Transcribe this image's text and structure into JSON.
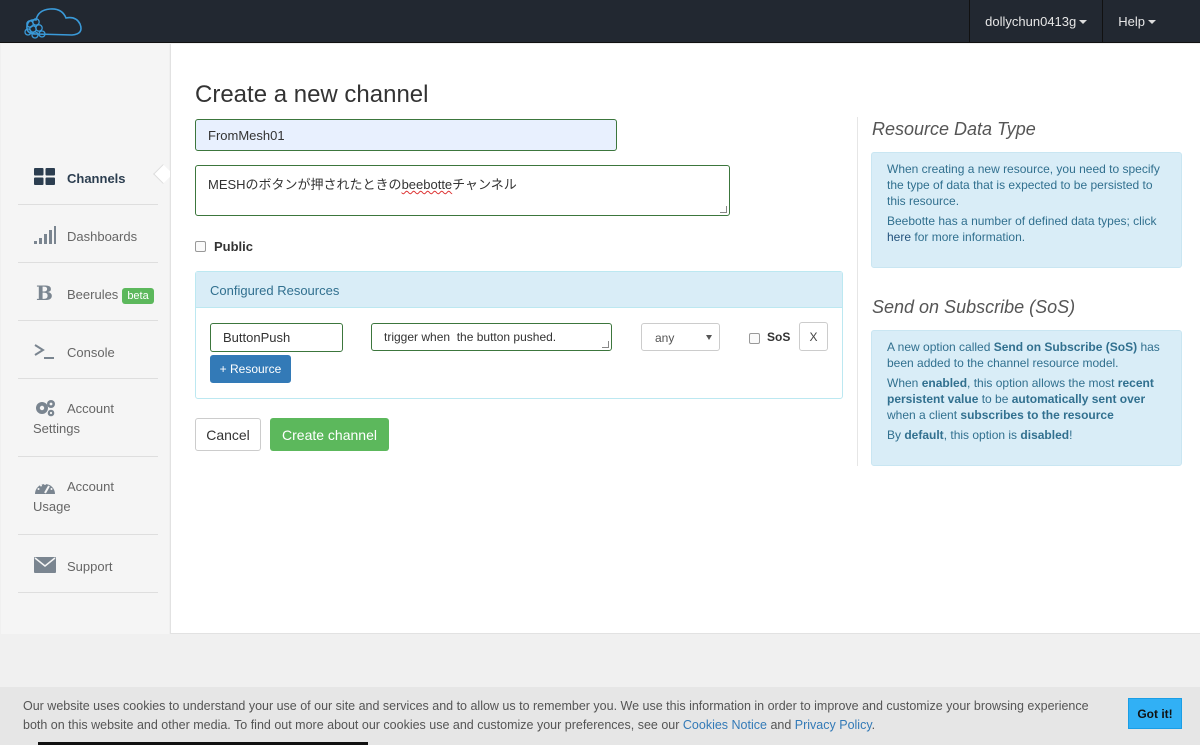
{
  "navbar": {
    "user_menu": "dollychun0413g",
    "help_menu": "Help",
    "logo_icon": "beebotte-cloud-logo"
  },
  "sidebar": {
    "items": [
      {
        "label": "Channels",
        "icon": "grid-icon",
        "active": true
      },
      {
        "label": "Dashboards",
        "icon": "signal-bars-icon"
      },
      {
        "label": "Beerules",
        "icon": "b-icon",
        "badge": "beta"
      },
      {
        "label": "Console",
        "icon": "terminal-icon"
      },
      {
        "label": "Account Settings",
        "icon": "gears-icon"
      },
      {
        "label": "Account Usage",
        "icon": "gauge-icon"
      },
      {
        "label": "Support",
        "icon": "envelope-icon"
      }
    ]
  },
  "form": {
    "title": "Create a new channel",
    "channel_name": "FromMesh01",
    "description_before": "MESHのボタンが押されたときの",
    "description_spell": "beebotte",
    "description_after": "チャンネル",
    "public_label": "Public",
    "public_checked": false,
    "resources_heading": "Configured Resources",
    "resources": [
      {
        "name": "ButtonPush",
        "description": "trigger when  the button pushed.",
        "type": "any",
        "sos_label": "SoS",
        "sos_checked": false,
        "remove_label": "X"
      }
    ],
    "add_resource_label": "+ Resource",
    "cancel_label": "Cancel",
    "create_label": "Create channel"
  },
  "help": {
    "resource_type": {
      "heading": "Resource Data Type",
      "p1": "When creating a new resource, you need to specify the type of data that is expected to be persisted to this resource.",
      "p2_before": "Beebotte has a number of defined data types; click ",
      "p2_link": "here",
      "p2_after": " for more information."
    },
    "sos": {
      "heading": "Send on Subscribe (SoS)",
      "p1_a": "A new option called ",
      "p1_b": "Send on Subscribe (SoS)",
      "p1_c": " has been added to the channel resource model.",
      "p2_a": "When ",
      "p2_b": "enabled",
      "p2_c": ", this option allows the most ",
      "p2_d": "recent persistent value",
      "p2_e": " to be ",
      "p2_f": "automatically sent over",
      "p2_g": " when a client ",
      "p2_h": "subscribes to the resource",
      "p3_a": "By ",
      "p3_b": "default",
      "p3_c": ", this option is ",
      "p3_d": "disabled",
      "p3_e": "!"
    }
  },
  "cookie": {
    "text": "Our website uses cookies to understand your use of our site and services and to allow us to remember you. We use this information in order to improve and customize your browsing experience both on this website and other media. To find out more about our cookies use and customize your preferences, see our ",
    "link1": "Cookies Notice",
    "mid": " and ",
    "link2": "Privacy Policy",
    "end": ".",
    "button": "Got it!"
  },
  "colors": {
    "navbar": "#222831",
    "success": "#5cb85c",
    "primary": "#337ab7",
    "info_bg": "#d9edf7",
    "cookie_btn": "#31b0f5"
  }
}
